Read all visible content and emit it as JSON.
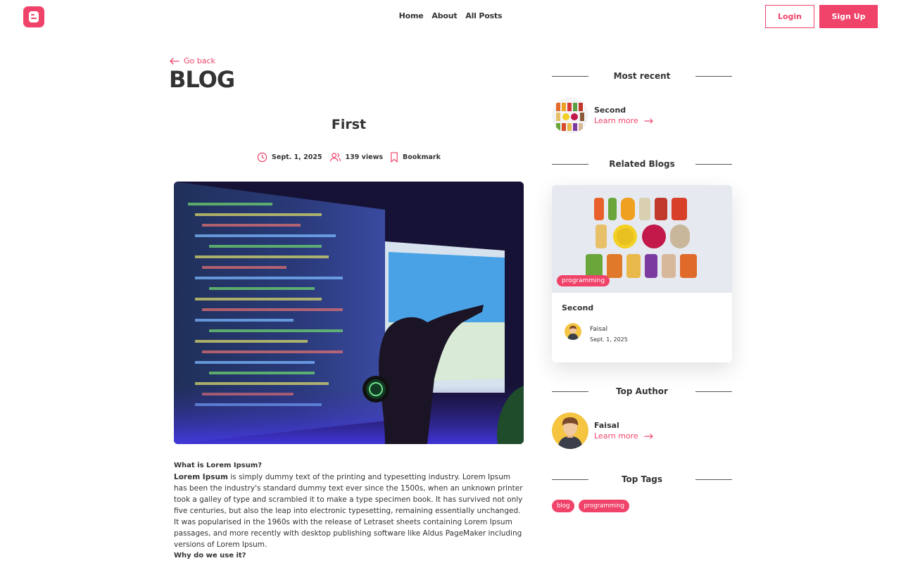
{
  "header": {
    "logo_icon": "blogger-logo-icon",
    "nav": [
      "Home",
      "About",
      "All Posts"
    ],
    "login_label": "Login",
    "signup_label": "Sign Up",
    "accent_color": "#f0436a"
  },
  "main": {
    "go_back_label": "Go back",
    "page_title": "BLOG",
    "post_title": "First",
    "date": "Sept. 1, 2025",
    "views": "139 views",
    "bookmark_label": "Bookmark",
    "hero_image": "monitor-code-photo",
    "content": {
      "heading1": "What is Lorem Ipsum?",
      "lead_bold": "Lorem Ipsum",
      "paragraph": " is simply dummy text of the printing and typesetting industry. Lorem Ipsum has been the industry's standard dummy text ever since the 1500s, when an unknown printer took a galley of type and scrambled it to make a type specimen book. It has survived not only five centuries, but also the leap into electronic typesetting, remaining essentially unchanged. It was popularised in the 1960s with the release of Letraset sheets containing Lorem Ipsum passages, and more recently with desktop publishing software like Aldus PageMaker including versions of Lorem Ipsum.",
      "heading2": "Why do we use it?"
    }
  },
  "sidebar": {
    "most_recent": {
      "heading": "Most recent",
      "title": "Second",
      "link": "Learn more"
    },
    "related": {
      "heading": "Related Blogs",
      "tag": "programming",
      "title": "Second",
      "author": "Faisal",
      "date": "Sept. 1, 2025"
    },
    "top_author": {
      "heading": "Top Author",
      "name": "Faisal",
      "link": "Learn more"
    },
    "top_tags": {
      "heading": "Top Tags",
      "tags": [
        "blog",
        "programming"
      ]
    }
  }
}
